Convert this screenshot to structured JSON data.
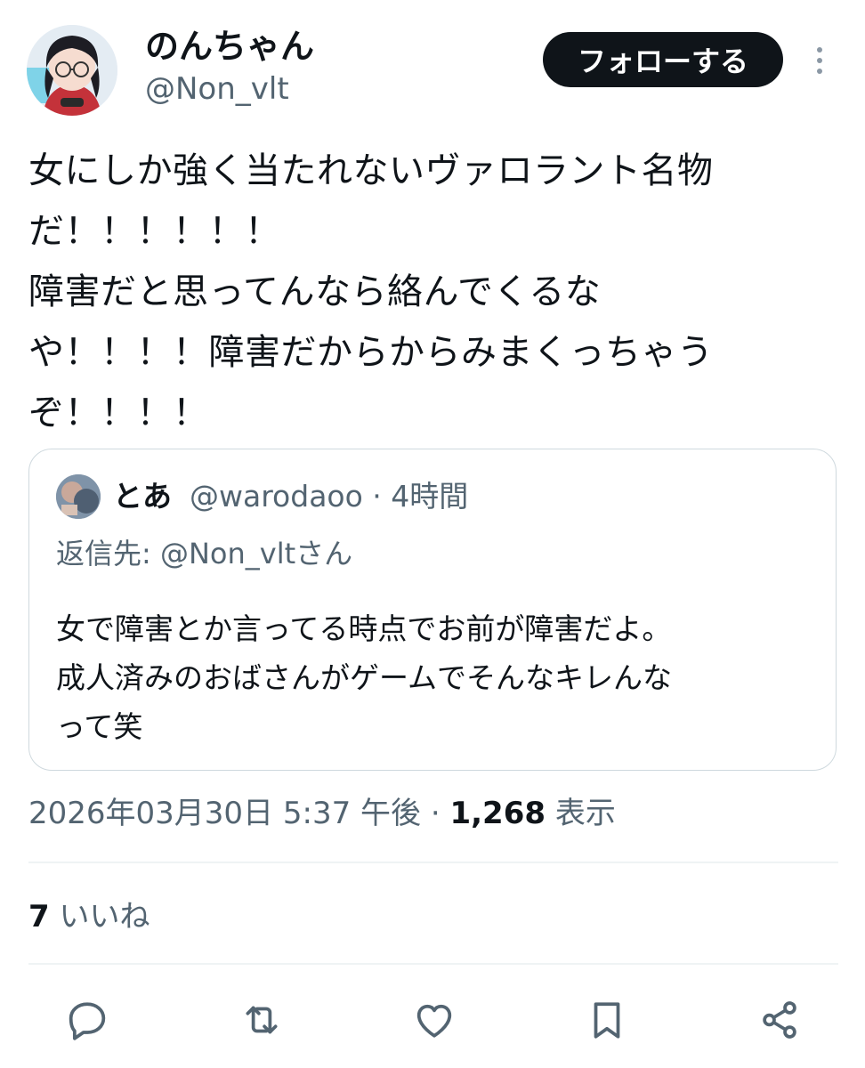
{
  "author": {
    "display_name": "のんちゃん",
    "handle": "@Non_vlt",
    "follow_label": "フォローする",
    "more_icon": "more-vertical-icon"
  },
  "tweet": {
    "text": "女にしか強く当たれないヴァロラント名物\nだ！！！！！！\n障害だと思ってんなら絡んでくるな\nや！！！！障害だからからみまくっちゃう\nぞ！！！！"
  },
  "quote": {
    "name": "とあ",
    "handle": "@warodaoo",
    "separator": "·",
    "time": "4時間",
    "reply_to": "返信先: @Non_vltさん",
    "text": "女で障害とか言ってる時点でお前が障害だよ。\n成人済みのおばさんがゲームでそんなキレんな\nって笑"
  },
  "meta": {
    "timestamp": "2026年03月30日 5:37 午後",
    "separator": "·",
    "views_count": "1,268",
    "views_label": "表示"
  },
  "likes": {
    "count": "7",
    "label": "いいね"
  },
  "actions": [
    {
      "name": "reply-icon"
    },
    {
      "name": "retweet-icon"
    },
    {
      "name": "like-icon"
    },
    {
      "name": "bookmark-icon"
    },
    {
      "name": "share-icon"
    }
  ],
  "colors": {
    "text_primary": "#0f1419",
    "text_secondary": "#536471",
    "border": "#cfd9de",
    "divider": "#eff3f4",
    "button_bg": "#0f1419"
  }
}
